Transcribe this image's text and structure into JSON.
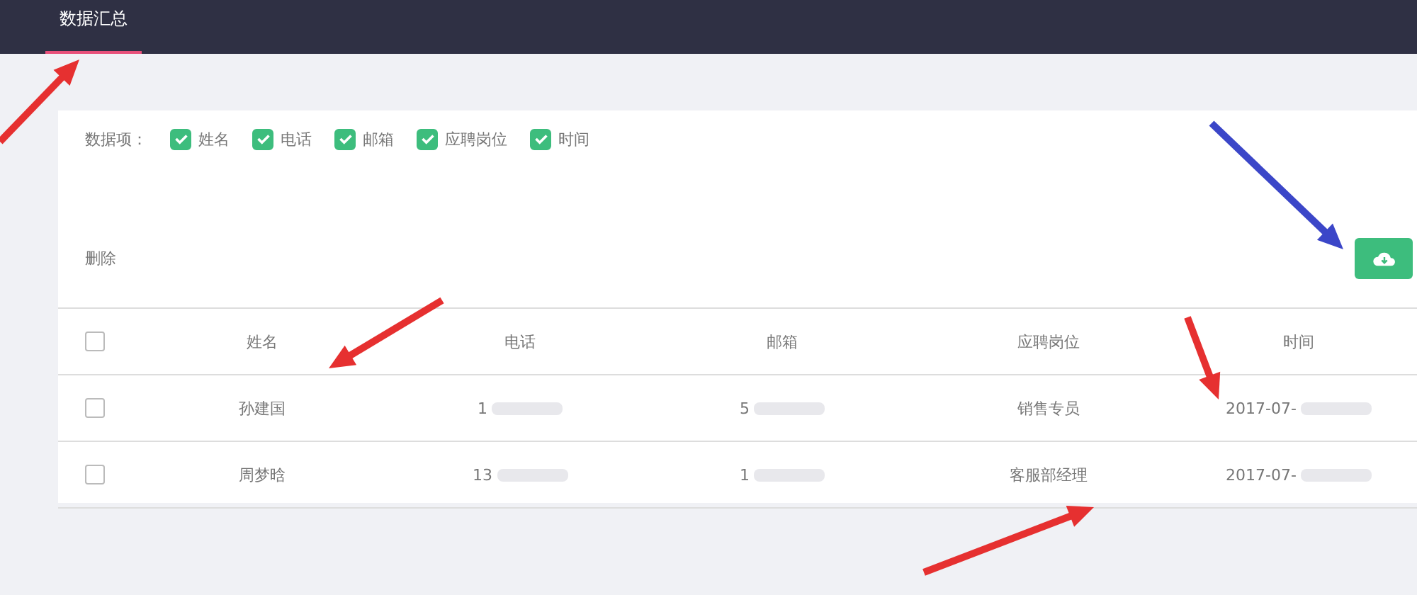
{
  "nav": {
    "tabs": [
      {
        "label": "数据汇总",
        "selected": true
      }
    ]
  },
  "fields": {
    "label": "数据项：",
    "items": [
      {
        "label": "姓名",
        "checked": true
      },
      {
        "label": "电话",
        "checked": true
      },
      {
        "label": "邮箱",
        "checked": true
      },
      {
        "label": "应聘岗位",
        "checked": true
      },
      {
        "label": "时间",
        "checked": true
      }
    ]
  },
  "delete_label": "删除",
  "table": {
    "header_checked": false,
    "columns": [
      "姓名",
      "电话",
      "邮箱",
      "应聘岗位",
      "时间"
    ],
    "rows": [
      {
        "checked": false,
        "cells": [
          "孙建国",
          "1",
          "5",
          "销售专员",
          "2017-07-"
        ]
      },
      {
        "checked": false,
        "cells": [
          "周梦晗",
          "13",
          "1",
          "客服部经理",
          "2017-07-"
        ]
      }
    ]
  }
}
